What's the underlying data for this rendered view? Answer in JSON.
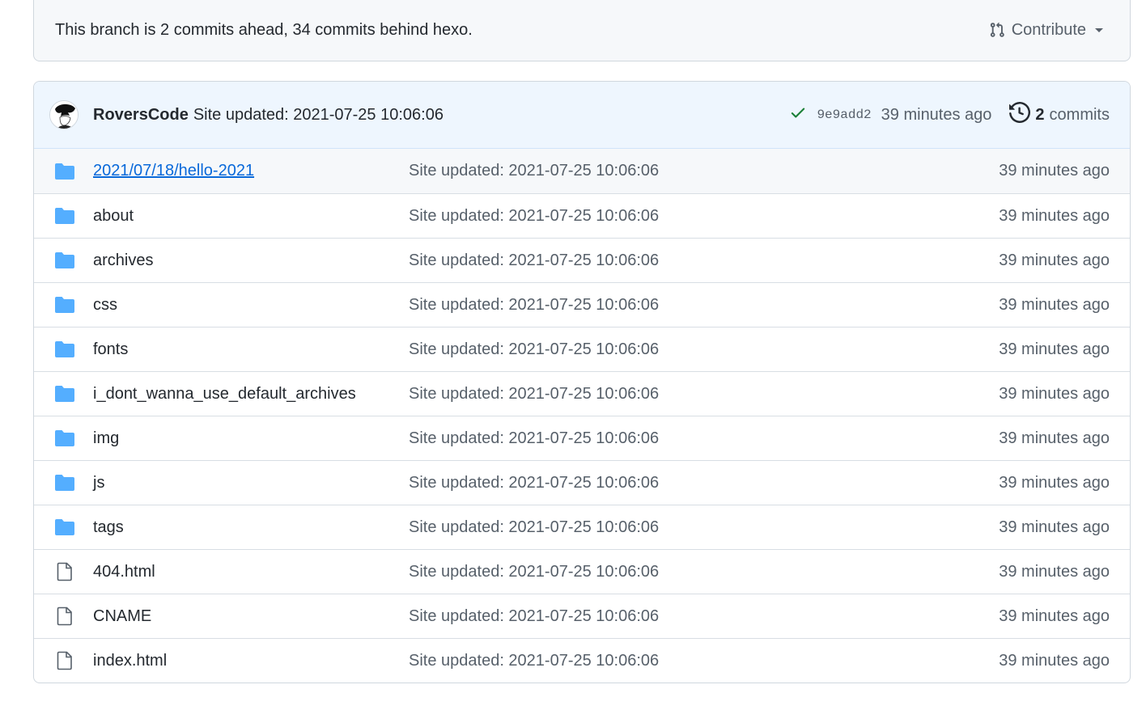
{
  "branch_bar": {
    "status_text": "This branch is 2 commits ahead, 34 commits behind hexo.",
    "contribute_label": "Contribute"
  },
  "latest_commit": {
    "author": "RoversCode",
    "message": "Site updated: 2021-07-25 10:06:06",
    "sha": "9e9add2",
    "time": "39 minutes ago",
    "commit_count": "2",
    "commit_count_label": "commits",
    "status": "success"
  },
  "files": [
    {
      "name": "2021/07/18/hello-2021",
      "type": "folder",
      "message": "Site updated: 2021-07-25 10:06:06",
      "time": "39 minutes ago"
    },
    {
      "name": "about",
      "type": "folder",
      "message": "Site updated: 2021-07-25 10:06:06",
      "time": "39 minutes ago"
    },
    {
      "name": "archives",
      "type": "folder",
      "message": "Site updated: 2021-07-25 10:06:06",
      "time": "39 minutes ago"
    },
    {
      "name": "css",
      "type": "folder",
      "message": "Site updated: 2021-07-25 10:06:06",
      "time": "39 minutes ago"
    },
    {
      "name": "fonts",
      "type": "folder",
      "message": "Site updated: 2021-07-25 10:06:06",
      "time": "39 minutes ago"
    },
    {
      "name": "i_dont_wanna_use_default_archives",
      "type": "folder",
      "message": "Site updated: 2021-07-25 10:06:06",
      "time": "39 minutes ago"
    },
    {
      "name": "img",
      "type": "folder",
      "message": "Site updated: 2021-07-25 10:06:06",
      "time": "39 minutes ago"
    },
    {
      "name": "js",
      "type": "folder",
      "message": "Site updated: 2021-07-25 10:06:06",
      "time": "39 minutes ago"
    },
    {
      "name": "tags",
      "type": "folder",
      "message": "Site updated: 2021-07-25 10:06:06",
      "time": "39 minutes ago"
    },
    {
      "name": "404.html",
      "type": "file",
      "message": "Site updated: 2021-07-25 10:06:06",
      "time": "39 minutes ago"
    },
    {
      "name": "CNAME",
      "type": "file",
      "message": "Site updated: 2021-07-25 10:06:06",
      "time": "39 minutes ago"
    },
    {
      "name": "index.html",
      "type": "file",
      "message": "Site updated: 2021-07-25 10:06:06",
      "time": "39 minutes ago"
    }
  ],
  "colors": {
    "folder": "#54aeff",
    "file": "#57606a",
    "link": "#0969da",
    "success": "#1a7f37"
  }
}
